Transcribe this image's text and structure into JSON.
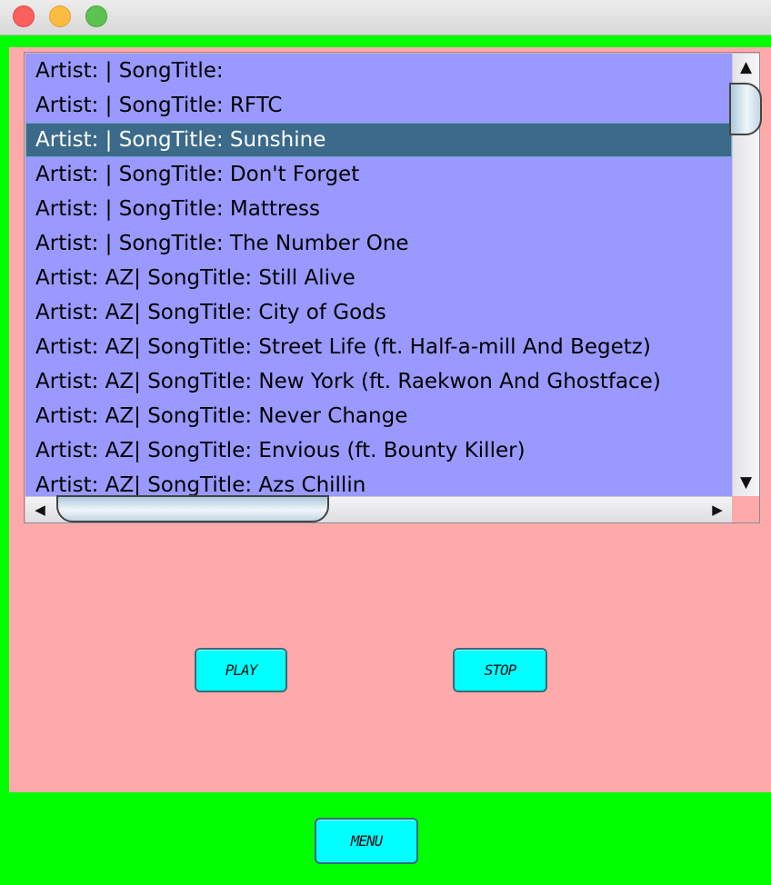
{
  "window": {
    "title": ""
  },
  "colors": {
    "frame": "#00ff00",
    "panel": "#ffaaaa",
    "list": "#9999ff",
    "selection": "#3c6a8a",
    "button": "#00ffff"
  },
  "songs": {
    "selected_index": 2,
    "items": [
      "Artist: | SongTitle:",
      "Artist: | SongTitle: RFTC",
      "Artist: | SongTitle: Sunshine",
      "Artist: | SongTitle: Don't Forget",
      "Artist: | SongTitle: Mattress",
      "Artist: | SongTitle: The Number One",
      "Artist: AZ| SongTitle: Still Alive",
      "Artist: AZ| SongTitle: City of Gods",
      "Artist: AZ| SongTitle: Street Life (ft. Half-a-mill And Begetz)",
      "Artist: AZ| SongTitle: New York (ft. Raekwon And Ghostface)",
      "Artist: AZ| SongTitle: Never Change",
      "Artist: AZ| SongTitle: Envious (ft. Bounty Killer)",
      "Artist: AZ| SongTitle: Azs Chillin"
    ]
  },
  "scrollbars": {
    "up_arrow": "▲",
    "down_arrow": "▼",
    "left_arrow": "◀",
    "right_arrow": "▶"
  },
  "controls": {
    "play_label": "PLAY",
    "stop_label": "STOP",
    "menu_label": "MENU"
  }
}
